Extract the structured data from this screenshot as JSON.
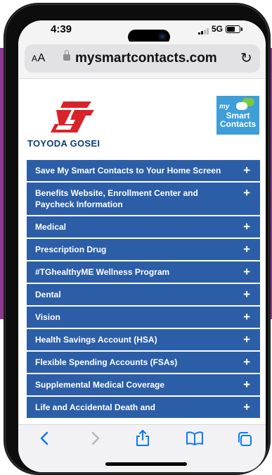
{
  "status_bar": {
    "time": "4:39",
    "network": "5G"
  },
  "browser": {
    "text_size_label": "AA",
    "url": "mysmartcontacts.com"
  },
  "page": {
    "company_logo_text": "TOYODA GOSEI",
    "brand_logo": {
      "line1": "my",
      "line2": "Smart",
      "line3": "Contacts"
    },
    "accordion": [
      {
        "label": "Save My Smart Contacts to Your Home Screen",
        "icon": "+"
      },
      {
        "label": "Benefits Website, Enrollment Center and Paycheck Information",
        "icon": "+"
      },
      {
        "label": "Medical",
        "icon": "+"
      },
      {
        "label": "Prescription Drug",
        "icon": "+"
      },
      {
        "label": "#TGhealthyME Wellness Program",
        "icon": "+"
      },
      {
        "label": "Dental",
        "icon": "+"
      },
      {
        "label": "Vision",
        "icon": "+"
      },
      {
        "label": "Health Savings Account (HSA)",
        "icon": "+"
      },
      {
        "label": "Flexible Spending Accounts (FSAs)",
        "icon": "+"
      },
      {
        "label": "Supplemental Medical Coverage",
        "icon": "+"
      },
      {
        "label": "Life and Accidental Death and",
        "icon": "+"
      }
    ]
  },
  "toolbar": {
    "icons": [
      "back-icon",
      "forward-icon",
      "share-icon",
      "bookmarks-icon",
      "tabs-icon"
    ]
  },
  "colors": {
    "accordion_bg": "#2c5ea8",
    "brand_red": "#d8232a",
    "brand_navy": "#0b3d78",
    "backdrop_purple": "#8e3a91",
    "smart_blue": "#3e9ed8"
  }
}
